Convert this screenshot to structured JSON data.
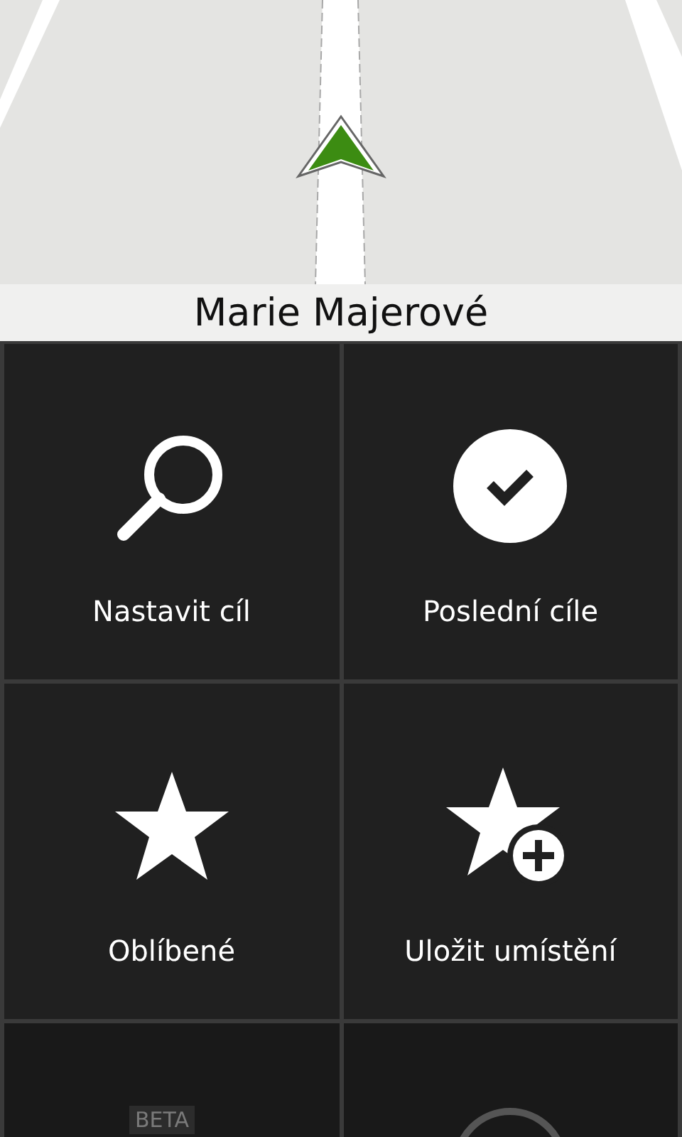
{
  "map": {
    "kind": "picture",
    "street": "Marie Majerové"
  },
  "tiles": [
    {
      "kind": "search",
      "label": "Nastavit cíl",
      "disabled": false
    },
    {
      "kind": "check",
      "label": "Poslední cíle",
      "disabled": false
    },
    {
      "kind": "star",
      "label": "Oblíbené",
      "disabled": false
    },
    {
      "kind": "star-add",
      "label": "Uložit umístění",
      "disabled": false
    },
    {
      "kind": "beta",
      "badge": "BETA",
      "disabled": true
    },
    {
      "kind": "ring",
      "disabled": true
    }
  ]
}
